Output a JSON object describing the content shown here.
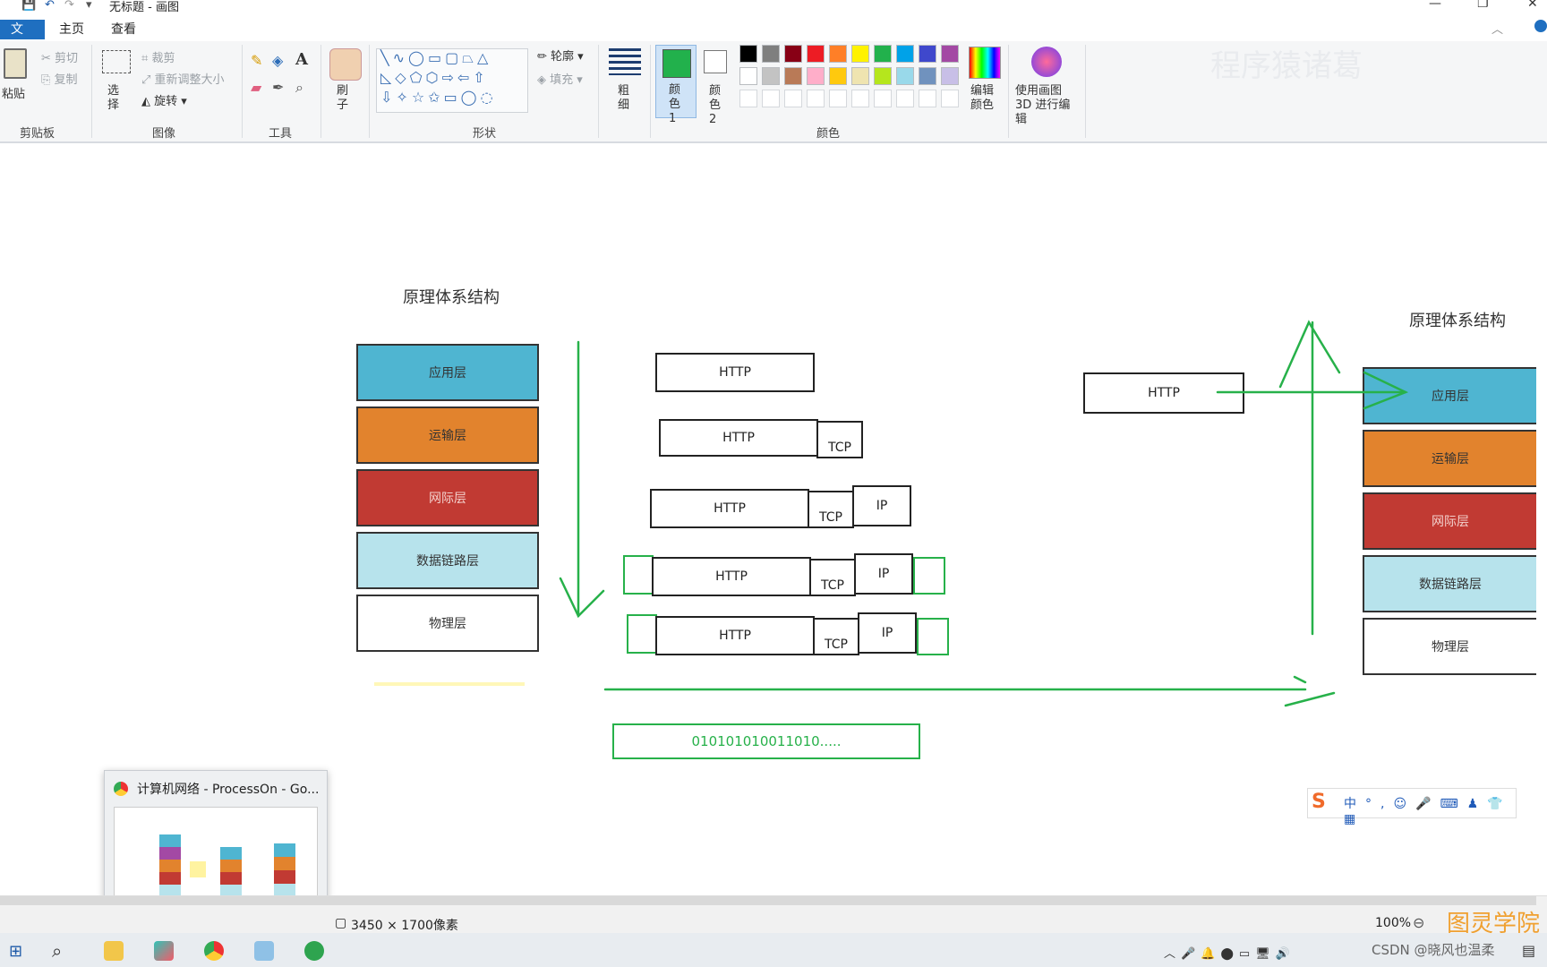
{
  "window": {
    "title": "无标题 - 画图"
  },
  "tabs": {
    "file": "文件",
    "home": "主页",
    "view": "查看"
  },
  "ribbon": {
    "clipboard": {
      "paste": "粘贴",
      "cut": "剪切",
      "copy": "复制",
      "label": "剪贴板"
    },
    "image": {
      "select": "选择",
      "crop": "裁剪",
      "resize": "重新调整大小",
      "rotate": "旋转",
      "label": "图像"
    },
    "tools": {
      "label": "工具"
    },
    "brush": {
      "label": "刷子"
    },
    "shapes": {
      "outline": "轮廓",
      "fill": "填充",
      "label": "形状"
    },
    "size": {
      "label": "粗细"
    },
    "color1": {
      "label": "颜色 1"
    },
    "color2": {
      "label": "颜色 2"
    },
    "colors": {
      "label": "颜色",
      "edit": "编辑颜色",
      "row1": [
        "#000000",
        "#7f7f7f",
        "#880015",
        "#ed1c24",
        "#ff7f27",
        "#fff200",
        "#22b14c",
        "#00a2e8",
        "#3f48cc",
        "#a349a4"
      ],
      "row2": [
        "#ffffff",
        "#c3c3c3",
        "#b97a57",
        "#ffaec9",
        "#ffc90e",
        "#efe4b0",
        "#b5e61d",
        "#99d9ea",
        "#7092be",
        "#c8bfe7"
      ]
    },
    "paint3d": "使用画图 3D 进行编辑",
    "watermark": "程序猿诸葛"
  },
  "diagram": {
    "left_title": "原理体系结构",
    "right_title": "原理体系结构",
    "layers": [
      {
        "label": "应用层",
        "color": "#4fb5d1"
      },
      {
        "label": "运输层",
        "color": "#e2832d"
      },
      {
        "label": "网际层",
        "color": "#c13a33"
      },
      {
        "label": "数据链路层",
        "color": "#b7e3ec"
      },
      {
        "label": "物理层",
        "color": "#ffffff"
      }
    ],
    "http": "HTTP",
    "tcp": "TCP",
    "ip": "IP",
    "bits": "010101010011010....."
  },
  "statusbar": {
    "dimensions": "3450 × 1700像素",
    "zoom": "100%"
  },
  "thumbnail": {
    "title": "计算机网络 - ProcessOn - Go..."
  },
  "overlay": {
    "brand": "图灵学院",
    "credit": "CSDN @晓风也温柔"
  }
}
